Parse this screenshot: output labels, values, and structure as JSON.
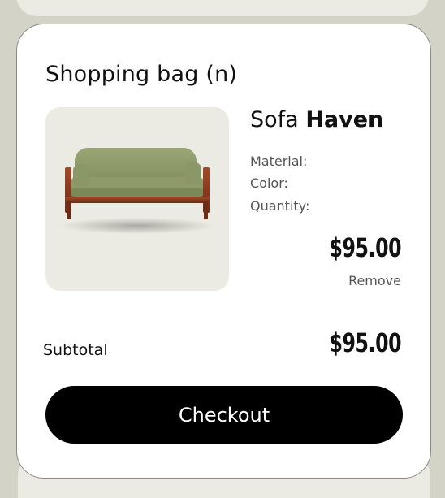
{
  "bag": {
    "title": "Shopping bag (n)",
    "item": {
      "name_prefix": "Sofa",
      "name_bold": "Haven",
      "material_label": "Material:",
      "color_label": "Color:",
      "quantity_label": "Quantity:",
      "price": "$95.00",
      "remove_label": "Remove"
    },
    "subtotal_label": "Subtotal",
    "subtotal_value": "$95.00",
    "checkout_label": "Checkout"
  },
  "colors": {
    "background": "#d3d3c8",
    "card": "#ffffff",
    "thumbnail_bg": "#ecebe3",
    "checkout_bg": "#000000",
    "sofa_upholstery": "#8d9a68",
    "sofa_frame": "#8b3b22"
  }
}
